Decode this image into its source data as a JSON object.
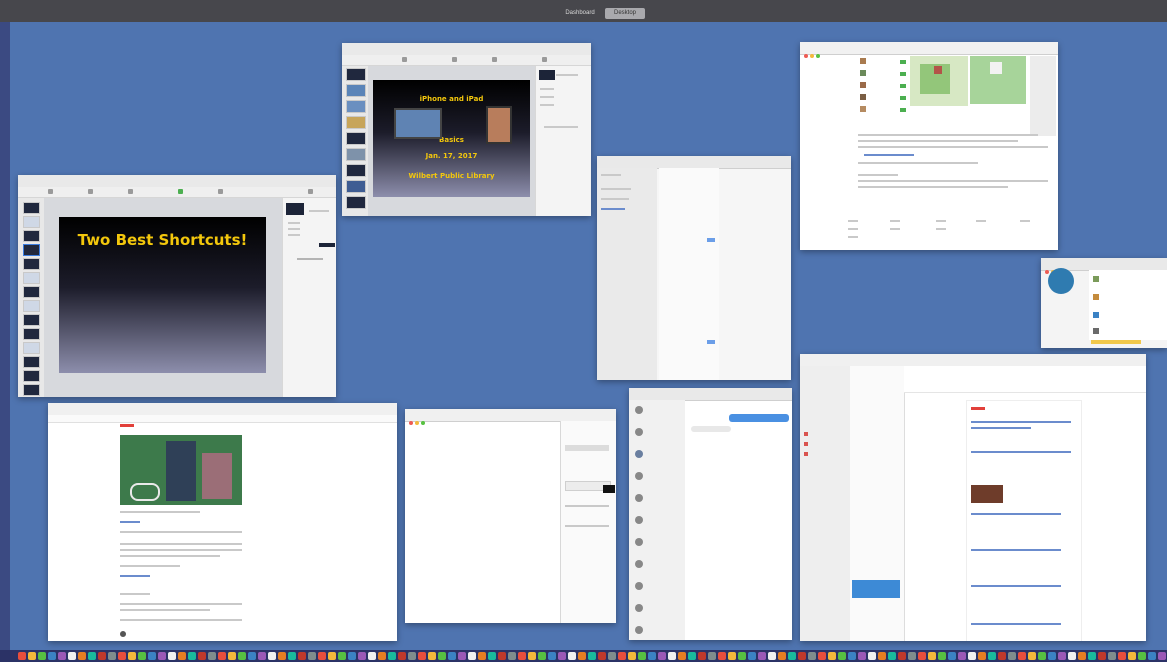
{
  "spaces": {
    "tabs": [
      {
        "label": "Dashboard",
        "active": false
      },
      {
        "label": "Desktop",
        "active": true
      }
    ]
  },
  "windows": {
    "keynote_main": {
      "slide_title": "Two Best Shortcuts!"
    },
    "keynote_second": {
      "slide_lines": [
        "iPhone and iPad",
        "Basics",
        "Jan. 17, 2017",
        "Wilbert Public Library"
      ]
    }
  },
  "colors": {
    "desktop": "#4f74b0",
    "slide_text": "#f3c70c",
    "spaces_bar": "#47474c"
  },
  "icons": {
    "dock": "app-icons"
  }
}
